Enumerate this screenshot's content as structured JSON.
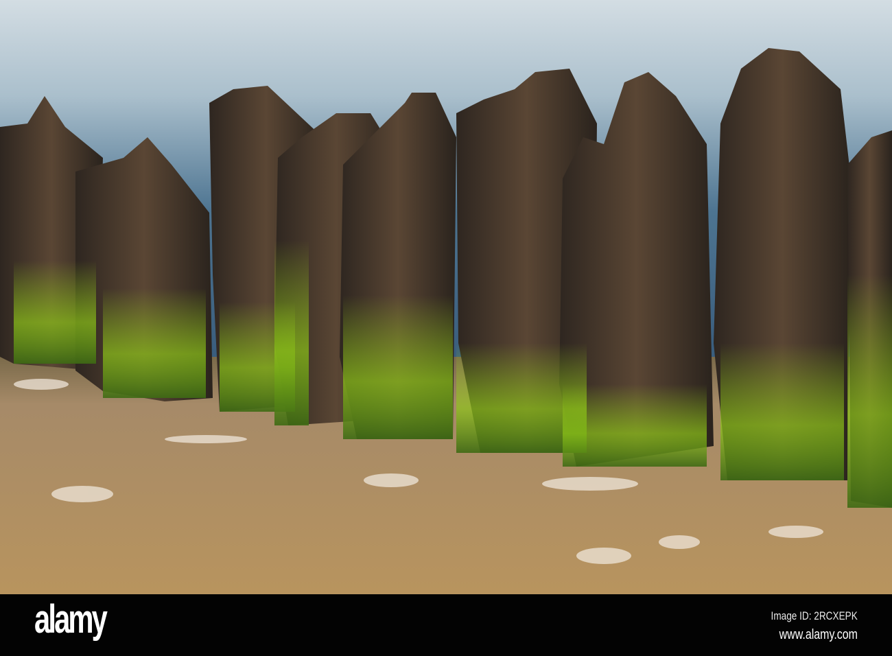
{
  "watermark": {
    "logo_text": "alamy",
    "image_id": "Image ID: 2RCXEPK",
    "website": "www.alamy.com"
  },
  "colors": {
    "sky_top": "#c9d6de",
    "sky_bottom": "#3f6683",
    "wood": "#4a3a2c",
    "algae": "#9bd11a",
    "water": "#a98a66"
  }
}
